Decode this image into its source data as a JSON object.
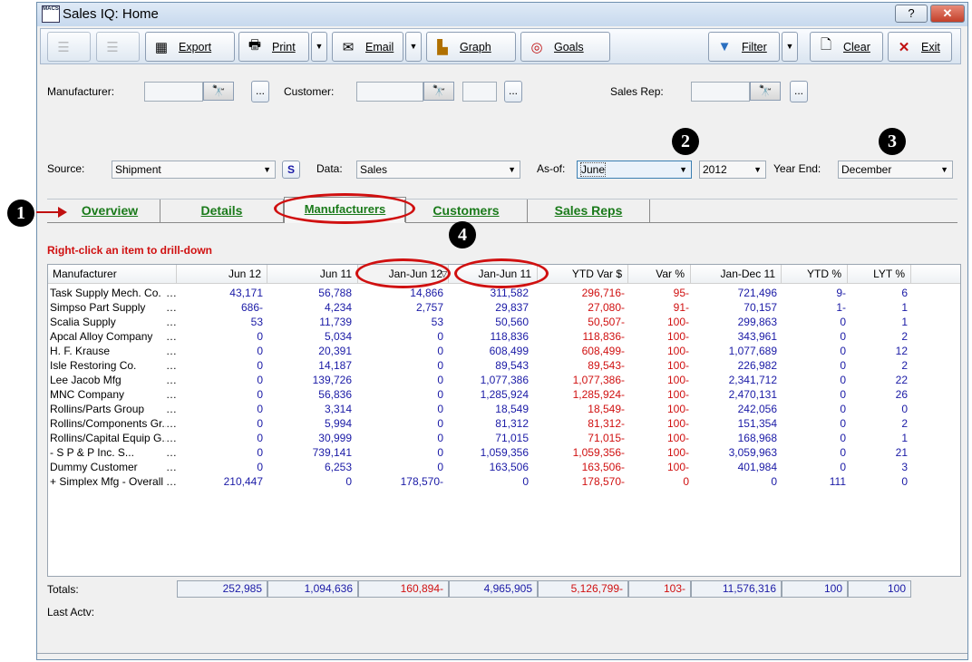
{
  "window": {
    "title": "Sales IQ: Home",
    "logo_text": "MACS",
    "help_label": "?",
    "close_label": "✕"
  },
  "toolbar": {
    "export": "Export",
    "print": "Print",
    "email": "Email",
    "graph": "Graph",
    "goals": "Goals",
    "filter": "Filter",
    "clear": "Clear",
    "exit": "Exit"
  },
  "filters": {
    "manufacturer_label": "Manufacturer:",
    "customer_label": "Customer:",
    "sales_rep_label": "Sales Rep:",
    "ellipsis": "...",
    "source_label": "Source:",
    "source_value": "Shipment",
    "s_button": "S",
    "data_label": "Data:",
    "data_value": "Sales",
    "asof_label": "As-of:",
    "asof_month": "June",
    "asof_year": "2012",
    "yearend_label": "Year End:",
    "yearend_value": "December"
  },
  "callouts": [
    "1",
    "2",
    "3",
    "4"
  ],
  "tabs": [
    "Overview",
    "Details",
    "Manufacturers",
    "Customers",
    "Sales Reps"
  ],
  "hint": "Right-click an item to drill-down",
  "columns": [
    "Manufacturer",
    "Jun 12",
    "Jun 11",
    "Jan-Jun 12",
    "Jan-Jun 11",
    "YTD Var $",
    "Var %",
    "Jan-Dec 11",
    "YTD %",
    "LYT %"
  ],
  "rows": [
    [
      "Task Supply Mech. Co.",
      "43,171",
      "56,788",
      "14,866",
      "311,582",
      "296,716-",
      "95-",
      "721,496",
      "9-",
      "6"
    ],
    [
      "Simpso Part Supply",
      "686-",
      "4,234",
      "2,757",
      "29,837",
      "27,080-",
      "91-",
      "70,157",
      "1-",
      "1"
    ],
    [
      "Scalia Supply",
      "53",
      "11,739",
      "53",
      "50,560",
      "50,507-",
      "100-",
      "299,863",
      "0",
      "1"
    ],
    [
      "Apcal Alloy Company",
      "0",
      "5,034",
      "0",
      "118,836",
      "118,836-",
      "100-",
      "343,961",
      "0",
      "2"
    ],
    [
      "H. F. Krause",
      "0",
      "20,391",
      "0",
      "608,499",
      "608,499-",
      "100-",
      "1,077,689",
      "0",
      "12"
    ],
    [
      "Isle Restoring Co.",
      "0",
      "14,187",
      "0",
      "89,543",
      "89,543-",
      "100-",
      "226,982",
      "0",
      "2"
    ],
    [
      "Lee Jacob Mfg",
      "0",
      "139,726",
      "0",
      "1,077,386",
      "1,077,386-",
      "100-",
      "2,341,712",
      "0",
      "22"
    ],
    [
      "MNC Company",
      "0",
      "56,836",
      "0",
      "1,285,924",
      "1,285,924-",
      "100-",
      "2,470,131",
      "0",
      "26"
    ],
    [
      "Rollins/Parts Group",
      "0",
      "3,314",
      "0",
      "18,549",
      "18,549-",
      "100-",
      "242,056",
      "0",
      "0"
    ],
    [
      "Rollins/Components Gr...",
      "0",
      "5,994",
      "0",
      "81,312",
      "81,312-",
      "100-",
      "151,354",
      "0",
      "2"
    ],
    [
      "Rollins/Capital Equip G...",
      "0",
      "30,999",
      "0",
      "71,015",
      "71,015-",
      "100-",
      "168,968",
      "0",
      "1"
    ],
    [
      " - S P & P Inc.          S...",
      "0",
      "739,141",
      "0",
      "1,059,356",
      "1,059,356-",
      "100-",
      "3,059,963",
      "0",
      "21"
    ],
    [
      "Dummy Customer",
      "0",
      "6,253",
      "0",
      "163,506",
      "163,506-",
      "100-",
      "401,984",
      "0",
      "3"
    ],
    [
      " + Simplex Mfg - Overall ...",
      "210,447",
      "0",
      "178,570-",
      "0",
      "178,570-",
      "0",
      "0",
      "111",
      "0"
    ]
  ],
  "totals_label": "Totals:",
  "totals": [
    "252,985",
    "1,094,636",
    "160,894-",
    "4,965,905",
    "5,126,799-",
    "103-",
    "11,576,316",
    "100",
    "100"
  ],
  "last_actv_label": "Last Actv:",
  "colors": {
    "blue": "#1a1aa6",
    "red": "#d01010",
    "tab_green": "#1a7a1a"
  }
}
